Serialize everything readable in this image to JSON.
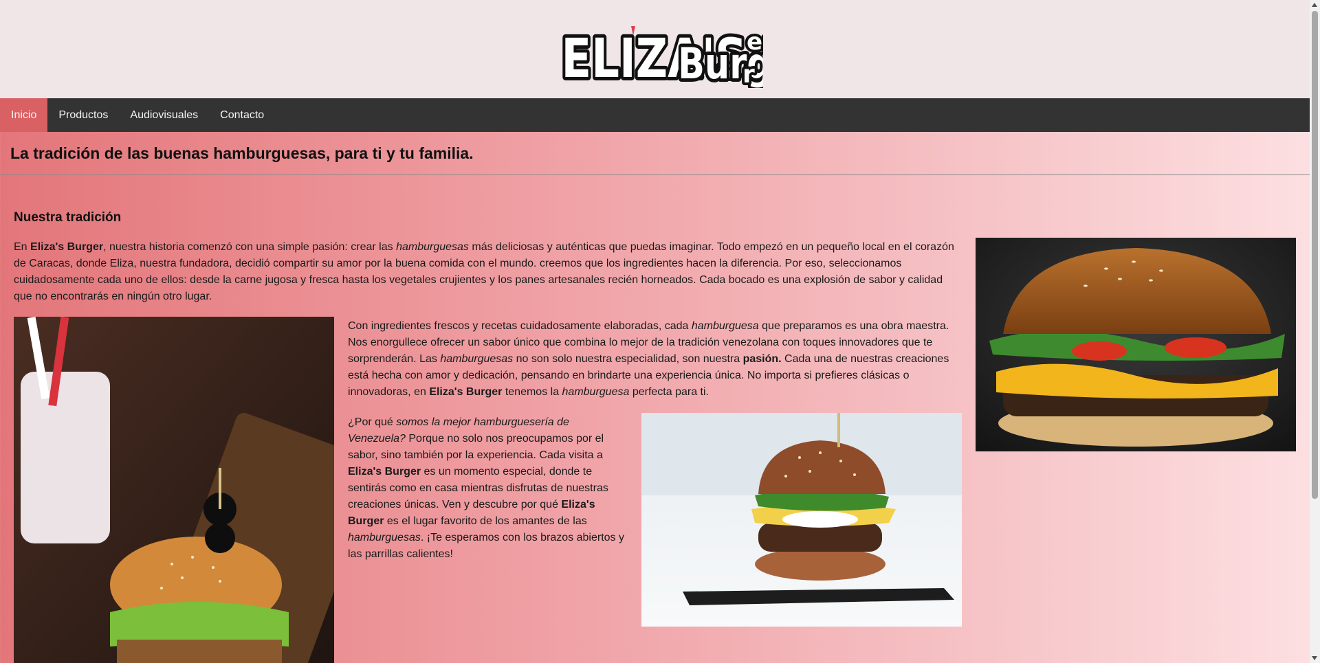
{
  "header": {
    "logo_text": "Eliza's Burger"
  },
  "nav": {
    "items": [
      {
        "label": "Inicio",
        "active": true
      },
      {
        "label": "Productos",
        "active": false
      },
      {
        "label": "Audiovisuales",
        "active": false
      },
      {
        "label": "Contacto",
        "active": false
      }
    ]
  },
  "tagline": "La tradición de las buenas hamburguesas, para ti y tu familia.",
  "main": {
    "section_title": "Nuestra tradición",
    "intro": {
      "t1": "En ",
      "b1": "Eliza's Burger",
      "t2": ", nuestra historia comenzó con una simple pasión: crear las ",
      "i1": "hamburguesas",
      "t3": " más deliciosas y auténticas que puedas imaginar. Todo empezó en un pequeño local en el corazón de Caracas, donde Eliza, nuestra fundadora, decidió compartir su amor por la buena comida con el mundo. creemos que los ingredientes hacen la diferencia. Por eso, seleccionamos cuidadosamente cada uno de ellos: desde la carne jugosa y fresca hasta los vegetales crujientes y los panes artesanales recién horneados. Cada bocado es una explosión de sabor y calidad que no encontrarás en ningún otro lugar."
    },
    "para2": {
      "t1": "Con ingredientes frescos y recetas cuidadosamente elaboradas, cada ",
      "i1": "hamburguesa",
      "t2": " que preparamos es una obra maestra. Nos enorgullece ofrecer un sabor único que combina lo mejor de la tradición venezolana con toques innovadores que te sorprenderán. Las ",
      "i2": "hamburguesas",
      "t3": " no son solo nuestra especialidad, son nuestra ",
      "b1": "pasión.",
      "t4": " Cada una de nuestras creaciones está hecha con amor y dedicación, pensando en brindarte una experiencia única. No importa si prefieres clásicas o innovadoras, en ",
      "b2": "Eliza's Burger",
      "t5": " tenemos la ",
      "i3": "hamburguesa",
      "t6": " perfecta para ti."
    },
    "para3": {
      "t1": "¿Por qué ",
      "i1": "somos la mejor hamburguesería de Venezuela?",
      "t2": " Porque no solo nos preocupamos por el sabor, sino también por la experiencia. Cada visita a ",
      "b1": "Eliza's Burger",
      "t3": " es un momento especial, donde te sentirás como en casa mientras disfrutas de nuestras creaciones únicas. Ven y descubre por qué ",
      "b2": "Eliza's Burger",
      "t4": " es el lugar favorito de los amantes de las ",
      "i2": "hamburguesas",
      "t5": ". ¡Te esperamos con los brazos abiertos y las parrillas calientes!"
    }
  },
  "colors": {
    "nav_bg": "#333333",
    "nav_active": "#d96063",
    "header_bg": "#f0e6e7"
  }
}
